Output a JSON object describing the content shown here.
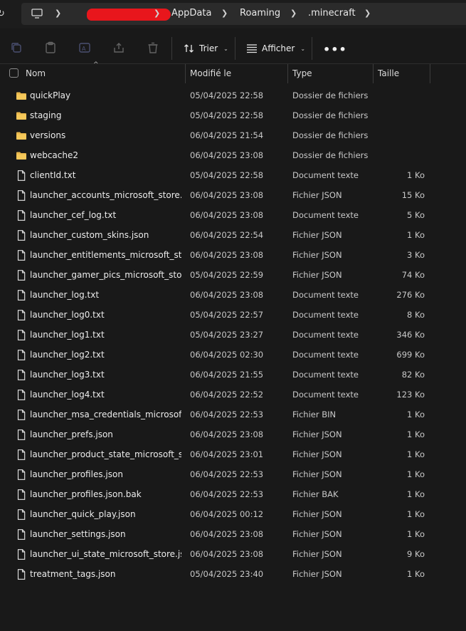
{
  "breadcrumb": {
    "items": [
      "AppData",
      "Roaming",
      ".minecraft"
    ]
  },
  "toolbar": {
    "sort_label": "Trier",
    "view_label": "Afficher",
    "more_label": "•••"
  },
  "columns": {
    "name": "Nom",
    "modified": "Modifié le",
    "type": "Type",
    "size": "Taille"
  },
  "colors": {
    "folder": "#e8b64c",
    "background": "#191919",
    "redaction": "#e8161c"
  },
  "files": [
    {
      "icon": "folder-icon",
      "name": "quickPlay",
      "modified": "05/04/2025 22:58",
      "type": "Dossier de fichiers",
      "size": ""
    },
    {
      "icon": "folder-icon",
      "name": "staging",
      "modified": "05/04/2025 22:58",
      "type": "Dossier de fichiers",
      "size": ""
    },
    {
      "icon": "folder-icon",
      "name": "versions",
      "modified": "06/04/2025 21:54",
      "type": "Dossier de fichiers",
      "size": ""
    },
    {
      "icon": "folder-icon",
      "name": "webcache2",
      "modified": "06/04/2025 23:08",
      "type": "Dossier de fichiers",
      "size": ""
    },
    {
      "icon": "file-icon",
      "name": "clientId.txt",
      "modified": "05/04/2025 22:58",
      "type": "Document texte",
      "size": "1 Ko"
    },
    {
      "icon": "file-icon",
      "name": "launcher_accounts_microsoft_store.json",
      "modified": "06/04/2025 23:08",
      "type": "Fichier JSON",
      "size": "15 Ko"
    },
    {
      "icon": "file-icon",
      "name": "launcher_cef_log.txt",
      "modified": "06/04/2025 23:08",
      "type": "Document texte",
      "size": "5 Ko"
    },
    {
      "icon": "file-icon",
      "name": "launcher_custom_skins.json",
      "modified": "06/04/2025 22:54",
      "type": "Fichier JSON",
      "size": "1 Ko"
    },
    {
      "icon": "file-icon",
      "name": "launcher_entitlements_microsoft_stor...",
      "modified": "06/04/2025 23:08",
      "type": "Fichier JSON",
      "size": "3 Ko"
    },
    {
      "icon": "file-icon",
      "name": "launcher_gamer_pics_microsoft_store....",
      "modified": "05/04/2025 22:59",
      "type": "Fichier JSON",
      "size": "74 Ko"
    },
    {
      "icon": "file-icon",
      "name": "launcher_log.txt",
      "modified": "06/04/2025 23:08",
      "type": "Document texte",
      "size": "276 Ko"
    },
    {
      "icon": "file-icon",
      "name": "launcher_log0.txt",
      "modified": "05/04/2025 22:57",
      "type": "Document texte",
      "size": "8 Ko"
    },
    {
      "icon": "file-icon",
      "name": "launcher_log1.txt",
      "modified": "05/04/2025 23:27",
      "type": "Document texte",
      "size": "346 Ko"
    },
    {
      "icon": "file-icon",
      "name": "launcher_log2.txt",
      "modified": "06/04/2025 02:30",
      "type": "Document texte",
      "size": "699 Ko"
    },
    {
      "icon": "file-icon",
      "name": "launcher_log3.txt",
      "modified": "06/04/2025 21:55",
      "type": "Document texte",
      "size": "82 Ko"
    },
    {
      "icon": "file-icon",
      "name": "launcher_log4.txt",
      "modified": "06/04/2025 22:52",
      "type": "Document texte",
      "size": "123 Ko"
    },
    {
      "icon": "file-icon",
      "name": "launcher_msa_credentials_microsoft_s...",
      "modified": "06/04/2025 22:53",
      "type": "Fichier BIN",
      "size": "1 Ko"
    },
    {
      "icon": "file-icon",
      "name": "launcher_prefs.json",
      "modified": "06/04/2025 23:08",
      "type": "Fichier JSON",
      "size": "1 Ko"
    },
    {
      "icon": "file-icon",
      "name": "launcher_product_state_microsoft_sto...",
      "modified": "06/04/2025 23:01",
      "type": "Fichier JSON",
      "size": "1 Ko"
    },
    {
      "icon": "file-icon",
      "name": "launcher_profiles.json",
      "modified": "06/04/2025 22:53",
      "type": "Fichier JSON",
      "size": "1 Ko"
    },
    {
      "icon": "file-icon",
      "name": "launcher_profiles.json.bak",
      "modified": "06/04/2025 22:53",
      "type": "Fichier BAK",
      "size": "1 Ko"
    },
    {
      "icon": "file-icon",
      "name": "launcher_quick_play.json",
      "modified": "06/04/2025 00:12",
      "type": "Fichier JSON",
      "size": "1 Ko"
    },
    {
      "icon": "file-icon",
      "name": "launcher_settings.json",
      "modified": "06/04/2025 23:08",
      "type": "Fichier JSON",
      "size": "1 Ko"
    },
    {
      "icon": "file-icon",
      "name": "launcher_ui_state_microsoft_store.json",
      "modified": "06/04/2025 23:08",
      "type": "Fichier JSON",
      "size": "9 Ko"
    },
    {
      "icon": "file-icon",
      "name": "treatment_tags.json",
      "modified": "05/04/2025 23:40",
      "type": "Fichier JSON",
      "size": "1 Ko"
    }
  ]
}
